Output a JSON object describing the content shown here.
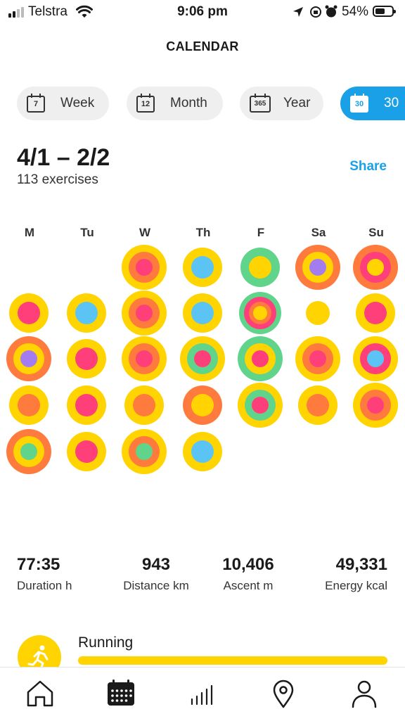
{
  "status_bar": {
    "carrier": "Telstra",
    "time": "9:06 pm",
    "battery": "54%"
  },
  "header": {
    "title": "CALENDAR"
  },
  "periods": [
    {
      "icon_number": "7",
      "label": "Week",
      "active": false
    },
    {
      "icon_number": "12",
      "label": "Month",
      "active": false
    },
    {
      "icon_number": "365",
      "label": "Year",
      "active": false
    },
    {
      "icon_number": "30",
      "label": "30",
      "active": true
    }
  ],
  "summary": {
    "range": "4/1 – 2/2",
    "exercises": "113 exercises",
    "share_label": "Share"
  },
  "weekdays": [
    "M",
    "Tu",
    "W",
    "Th",
    "F",
    "Sa",
    "Su"
  ],
  "colors": {
    "yellow": "#ffd400",
    "orange": "#ff7a3d",
    "pink": "#ff3f7a",
    "blue": "#5bc4f5",
    "green": "#5fd48a",
    "purple": "#a37cf0",
    "accent": "#1aa0e6"
  },
  "calendar_weeks": [
    [
      null,
      null,
      [
        "yellow",
        "orange",
        "pink"
      ],
      [
        "yellow",
        "blue"
      ],
      [
        "green",
        "yellow"
      ],
      [
        "orange",
        "yellow",
        "purple"
      ],
      [
        "orange",
        "pink",
        "yellow"
      ]
    ],
    [
      [
        "yellow",
        "pink"
      ],
      [
        "yellow",
        "blue"
      ],
      [
        "yellow",
        "orange",
        "pink"
      ],
      [
        "yellow",
        "blue"
      ],
      [
        "green",
        "pink",
        "orange",
        "yellow"
      ],
      [
        "yellow"
      ],
      [
        "yellow",
        "pink"
      ]
    ],
    [
      [
        "orange",
        "yellow",
        "purple"
      ],
      [
        "yellow",
        "pink"
      ],
      [
        "yellow",
        "orange",
        "pink"
      ],
      [
        "yellow",
        "green",
        "pink"
      ],
      [
        "green",
        "yellow",
        "pink"
      ],
      [
        "yellow",
        "orange",
        "pink"
      ],
      [
        "yellow",
        "pink",
        "blue"
      ]
    ],
    [
      [
        "yellow",
        "orange"
      ],
      [
        "yellow",
        "pink"
      ],
      [
        "yellow",
        "orange"
      ],
      [
        "orange",
        "yellow"
      ],
      [
        "yellow",
        "green",
        "pink"
      ],
      [
        "yellow",
        "orange"
      ],
      [
        "yellow",
        "orange",
        "pink"
      ]
    ],
    [
      [
        "orange",
        "yellow",
        "green"
      ],
      [
        "yellow",
        "pink"
      ],
      [
        "yellow",
        "orange",
        "green"
      ],
      [
        "yellow",
        "blue"
      ],
      null,
      null,
      null
    ]
  ],
  "stats": [
    {
      "value": "77:35",
      "label": "Duration h"
    },
    {
      "value": "943",
      "label": "Distance km"
    },
    {
      "value": "10,406",
      "label": "Ascent m"
    },
    {
      "value": "49,331",
      "label": "Energy kcal"
    }
  ],
  "activity": {
    "label": "Running",
    "icon": "running-icon",
    "share": 1.0
  },
  "tabs": [
    {
      "icon": "home-icon",
      "active": false
    },
    {
      "icon": "calendar-icon",
      "active": true
    },
    {
      "icon": "stats-icon",
      "active": false
    },
    {
      "icon": "map-pin-icon",
      "active": false
    },
    {
      "icon": "profile-icon",
      "active": false
    }
  ]
}
